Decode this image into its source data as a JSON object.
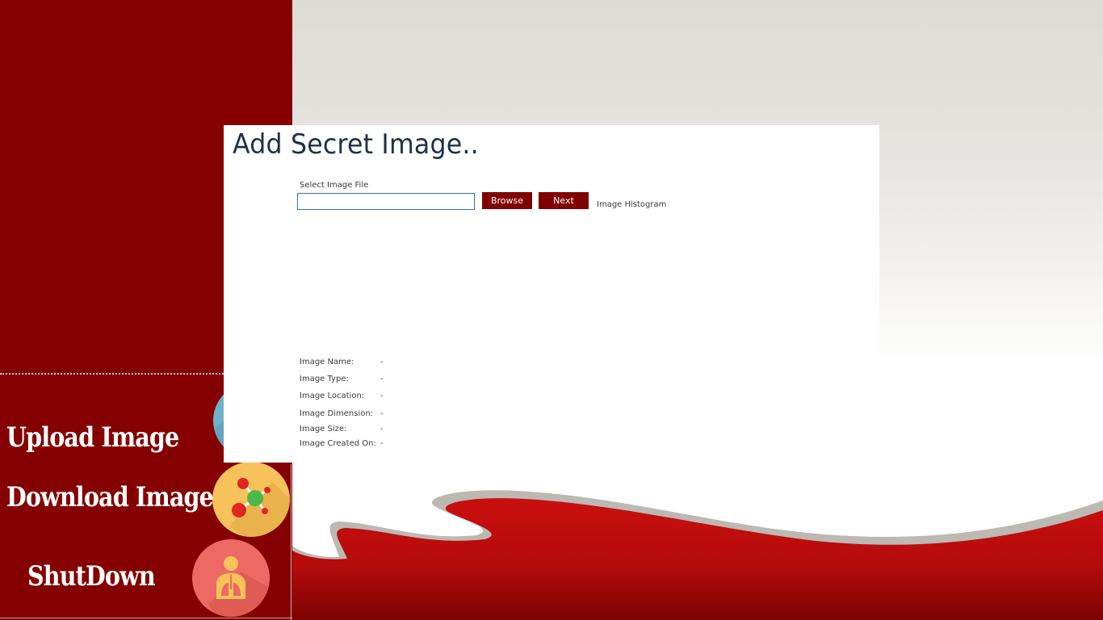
{
  "sidebar": {
    "nav": [
      {
        "label": "Upload Image",
        "icon": "upload-icon"
      },
      {
        "label": "Download Image",
        "icon": "molecule-icon"
      },
      {
        "label": "ShutDown",
        "icon": "person-lungs-icon"
      }
    ]
  },
  "panel": {
    "title": "Add Secret Image..",
    "file_label": "Select Image File",
    "file_value": "",
    "browse_label": "Browse",
    "next_label": "Next",
    "histogram_label": "Image Histogram",
    "info": [
      {
        "label": "Image Name:",
        "value": "-"
      },
      {
        "label": "Image Type:",
        "value": "-"
      },
      {
        "label": "Image Location:",
        "value": "-"
      },
      {
        "label": "Image Dimension:",
        "value": "-"
      },
      {
        "label": "Image Size:",
        "value": "-"
      },
      {
        "label": "Image Created On:",
        "value": "-"
      }
    ]
  },
  "colors": {
    "sidebar": "#850000",
    "button": "#7f0000",
    "wave_red": "#c00d0d",
    "title_text": "#1f3147",
    "input_border": "#2a7ab0"
  }
}
